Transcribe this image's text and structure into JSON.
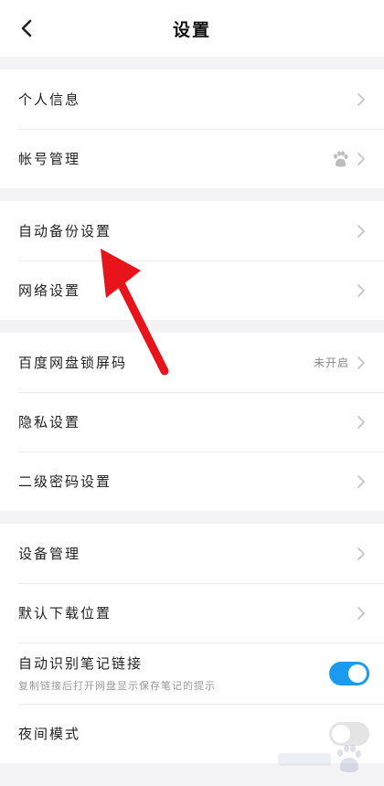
{
  "header": {
    "title": "设置",
    "back_icon": "chevron-left-icon"
  },
  "groups": [
    {
      "items": [
        {
          "label": "个人信息"
        },
        {
          "label": "帐号管理",
          "icon": "baidu-paw-icon"
        }
      ]
    },
    {
      "items": [
        {
          "label": "自动备份设置"
        },
        {
          "label": "网络设置"
        }
      ]
    },
    {
      "items": [
        {
          "label": "百度网盘锁屏码",
          "value": "未开启"
        },
        {
          "label": "隐私设置"
        },
        {
          "label": "二级密码设置"
        }
      ]
    },
    {
      "items": [
        {
          "label": "设备管理"
        },
        {
          "label": "默认下载位置"
        },
        {
          "label": "自动识别笔记链接",
          "subtitle": "复制链接后打开网盘显示保存笔记的提示",
          "toggle": true
        },
        {
          "label": "夜间模式",
          "toggle": false
        }
      ]
    }
  ],
  "annotation": {
    "arrow_color": "#e8141b"
  },
  "colors": {
    "accent": "#1a9bf0",
    "background": "#f3f3f5",
    "chevron": "#c4c4c4"
  }
}
